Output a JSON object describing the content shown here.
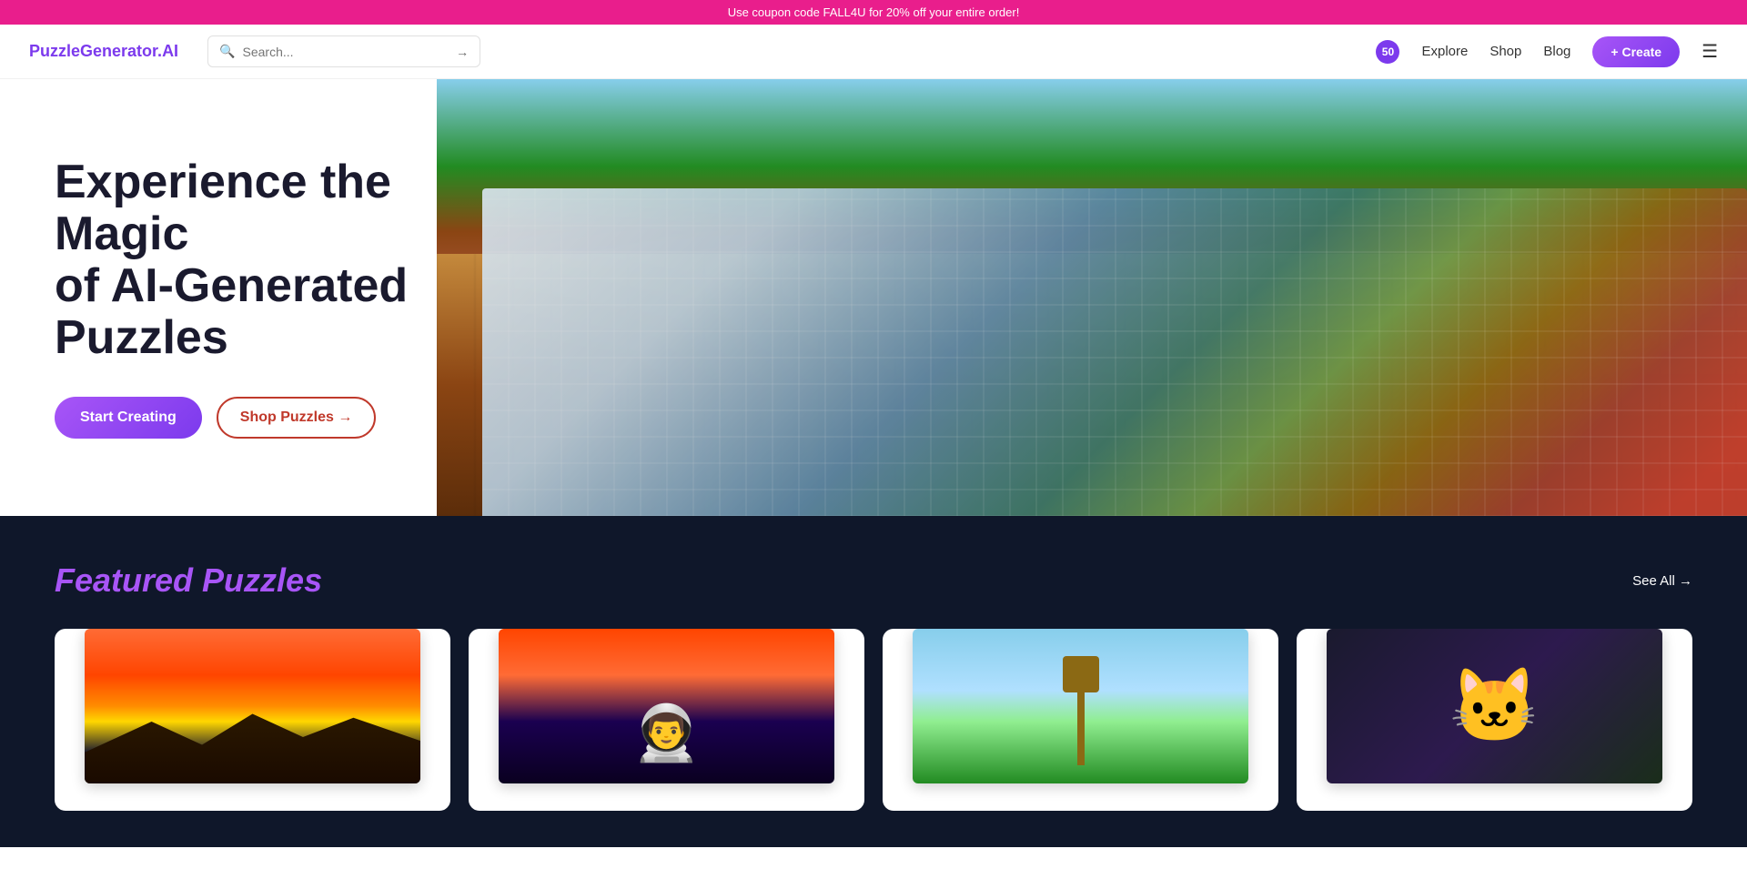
{
  "banner": {
    "text": "Use coupon code FALL4U for 20% off your entire order!"
  },
  "header": {
    "logo_text": "PuzzleGenerator.",
    "logo_accent": "AI",
    "search_placeholder": "Search...",
    "nav_badge": "50",
    "nav_explore": "Explore",
    "nav_shop": "Shop",
    "nav_blog": "Blog",
    "create_label": "+ Create"
  },
  "hero": {
    "title_line1": "Experience the Magic",
    "title_line2": "of AI-Generated Puzzles",
    "btn_primary": "Start Creating",
    "btn_outline": "Shop Puzzles →"
  },
  "featured": {
    "title_plain": "Featured ",
    "title_accent": "Puzzles",
    "see_all": "See All →",
    "puzzles": [
      {
        "id": 1,
        "type": "sunset-mountains"
      },
      {
        "id": 2,
        "type": "astronaut"
      },
      {
        "id": 3,
        "type": "windmill"
      },
      {
        "id": 4,
        "type": "cat-glasses"
      }
    ]
  }
}
